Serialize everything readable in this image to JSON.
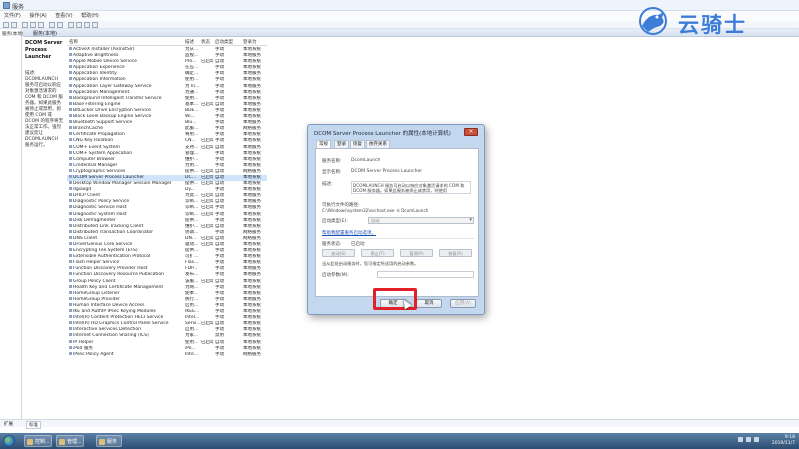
{
  "window": {
    "title": "服务"
  },
  "menu": [
    "文件(F)",
    "操作(A)",
    "查看(V)",
    "帮助(H)"
  ],
  "tree": {
    "root": "服务(本地)"
  },
  "strip": {
    "title": "服务(本地)"
  },
  "description_pane": {
    "title": "DCOM Server Process Launcher",
    "body": "描述:\nDCOMLAUNCH 服务可启动以响应对象激活请求的 COM 和 DCOM 服务器。如果此服务被停止或禁用，则使用 COM 或 DCOM 的程序将无法正常工作。强烈建议您让 DCOMLAUNCH 服务运行。"
  },
  "columns": {
    "name": "名称",
    "desc": "描述",
    "status": "状态",
    "startup": "启动类型",
    "logon": "登录为"
  },
  "services": [
    {
      "name": "ActiveX Installer (AxInstSV)",
      "desc": "为从...",
      "status": "",
      "startup": "手动",
      "logon": "本地系统"
    },
    {
      "name": "Adaptive Brightness",
      "desc": "监视...",
      "status": "",
      "startup": "手动",
      "logon": "本地服务"
    },
    {
      "name": "Apple Mobile Device Service",
      "desc": "Pro...",
      "status": "已启动",
      "startup": "自动",
      "logon": "本地系统"
    },
    {
      "name": "Application Experience",
      "desc": "在应...",
      "status": "",
      "startup": "手动",
      "logon": "本地系统"
    },
    {
      "name": "Application Identity",
      "desc": "确定...",
      "status": "",
      "startup": "手动",
      "logon": "本地服务"
    },
    {
      "name": "Application Information",
      "desc": "使用...",
      "status": "",
      "startup": "手动",
      "logon": "本地系统"
    },
    {
      "name": "Application Layer Gateway Service",
      "desc": "为 In...",
      "status": "",
      "startup": "手动",
      "logon": "本地服务"
    },
    {
      "name": "Application Management",
      "desc": "为通...",
      "status": "",
      "startup": "手动",
      "logon": "本地系统"
    },
    {
      "name": "Background Intelligent Transfer Service",
      "desc": "使用...",
      "status": "",
      "startup": "手动",
      "logon": "本地系统"
    },
    {
      "name": "Base Filtering Engine",
      "desc": "基本...",
      "status": "已启动",
      "startup": "自动",
      "logon": "本地服务"
    },
    {
      "name": "BitLocker Drive Encryption Service",
      "desc": "BDE...",
      "status": "",
      "startup": "手动",
      "logon": "本地系统"
    },
    {
      "name": "Block Level Backup Engine Service",
      "desc": "Wi...",
      "status": "",
      "startup": "手动",
      "logon": "本地系统"
    },
    {
      "name": "Bluetooth Support Service",
      "desc": "Blu...",
      "status": "",
      "startup": "手动",
      "logon": "本地服务"
    },
    {
      "name": "BranchCache",
      "desc": "此服...",
      "status": "",
      "startup": "手动",
      "logon": "网络服务"
    },
    {
      "name": "Certificate Propagation",
      "desc": "将用...",
      "status": "",
      "startup": "手动",
      "logon": "本地系统"
    },
    {
      "name": "CNG Key Isolation",
      "desc": "CN...",
      "status": "已启动",
      "startup": "手动",
      "logon": "本地系统"
    },
    {
      "name": "COM+ Event System",
      "desc": "支持...",
      "status": "已启动",
      "startup": "自动",
      "logon": "本地服务"
    },
    {
      "name": "COM+ System Application",
      "desc": "管理...",
      "status": "",
      "startup": "手动",
      "logon": "本地系统"
    },
    {
      "name": "Computer Browser",
      "desc": "维护...",
      "status": "",
      "startup": "手动",
      "logon": "本地系统"
    },
    {
      "name": "Credential Manager",
      "desc": "为用...",
      "status": "",
      "startup": "手动",
      "logon": "本地系统"
    },
    {
      "name": "Cryptographic Services",
      "desc": "提供...",
      "status": "已启动",
      "startup": "自动",
      "logon": "网络服务"
    },
    {
      "name": "DCOM Server Process Launcher",
      "desc": "DC...",
      "status": "已启动",
      "startup": "自动",
      "logon": "本地系统",
      "selected": true
    },
    {
      "name": "Desktop Window Manager Session Manager",
      "desc": "提供...",
      "status": "已启动",
      "startup": "自动",
      "logon": "本地系统"
    },
    {
      "name": "dgiaxgd",
      "desc": "Dy...",
      "status": "",
      "startup": "手动",
      "logon": "本地系统"
    },
    {
      "name": "DHCP Client",
      "desc": "为此...",
      "status": "已启动",
      "startup": "自动",
      "logon": "本地服务"
    },
    {
      "name": "Diagnostic Policy Service",
      "desc": "诊断...",
      "status": "已启动",
      "startup": "自动",
      "logon": "本地服务"
    },
    {
      "name": "Diagnostic Service Host",
      "desc": "诊断...",
      "status": "已启动",
      "startup": "手动",
      "logon": "本地服务"
    },
    {
      "name": "Diagnostic System Host",
      "desc": "诊断...",
      "status": "已启动",
      "startup": "手动",
      "logon": "本地系统"
    },
    {
      "name": "Disk Defragmenter",
      "desc": "提供...",
      "status": "",
      "startup": "手动",
      "logon": "本地系统"
    },
    {
      "name": "Distributed Link Tracking Client",
      "desc": "维护...",
      "status": "已启动",
      "startup": "自动",
      "logon": "本地系统"
    },
    {
      "name": "Distributed Transaction Coordinator",
      "desc": "协调...",
      "status": "",
      "startup": "手动",
      "logon": "网络服务"
    },
    {
      "name": "DNS Client",
      "desc": "DN...",
      "status": "已启动",
      "startup": "自动",
      "logon": "网络服务"
    },
    {
      "name": "DriverGenius Core Service",
      "desc": "驱动...",
      "status": "已启动",
      "startup": "自动",
      "logon": "本地系统"
    },
    {
      "name": "Encrypting File System (EFS)",
      "desc": "提供...",
      "status": "",
      "startup": "手动",
      "logon": "本地系统"
    },
    {
      "name": "Extensible Authentication Protocol",
      "desc": "可扩...",
      "status": "",
      "startup": "手动",
      "logon": "本地系统"
    },
    {
      "name": "Flash Helper Service",
      "desc": "Flas...",
      "status": "",
      "startup": "手动",
      "logon": "本地系统"
    },
    {
      "name": "Function Discovery Provider Host",
      "desc": "FDP...",
      "status": "",
      "startup": "手动",
      "logon": "本地服务"
    },
    {
      "name": "Function Discovery Resource Publication",
      "desc": "发布...",
      "status": "",
      "startup": "手动",
      "logon": "本地服务"
    },
    {
      "name": "Group Policy Client",
      "desc": "该服...",
      "status": "已启动",
      "startup": "自动",
      "logon": "本地系统"
    },
    {
      "name": "Health Key and Certificate Management",
      "desc": "为网...",
      "status": "",
      "startup": "手动",
      "logon": "本地系统"
    },
    {
      "name": "HomeGroup Listener",
      "desc": "使本...",
      "status": "",
      "startup": "手动",
      "logon": "本地系统"
    },
    {
      "name": "HomeGroup Provider",
      "desc": "执行...",
      "status": "",
      "startup": "手动",
      "logon": "本地服务"
    },
    {
      "name": "Human Interface Device Access",
      "desc": "启用...",
      "status": "",
      "startup": "手动",
      "logon": "本地系统"
    },
    {
      "name": "IKE and AuthIP IPsec Keying Modules",
      "desc": "IKEE...",
      "status": "",
      "startup": "手动",
      "logon": "本地系统"
    },
    {
      "name": "Intel(R) Content Protection HECI Service",
      "desc": "Intel...",
      "status": "",
      "startup": "手动",
      "logon": "本地系统"
    },
    {
      "name": "Intel(R) HD Graphics Control Panel Service",
      "desc": "Servi...",
      "status": "已启动",
      "startup": "自动",
      "logon": "本地系统"
    },
    {
      "name": "Interactive Services Detection",
      "desc": "启用...",
      "status": "",
      "startup": "手动",
      "logon": "本地系统"
    },
    {
      "name": "Internet Connection Sharing (ICS)",
      "desc": "为家...",
      "status": "",
      "startup": "禁用",
      "logon": "本地系统"
    },
    {
      "name": "IP Helper",
      "desc": "使用...",
      "status": "已启动",
      "startup": "自动",
      "logon": "本地系统"
    },
    {
      "name": "iPod 服务",
      "desc": "iPo...",
      "status": "",
      "startup": "手动",
      "logon": "本地系统"
    },
    {
      "name": "IPsec Policy Agent",
      "desc": "Inte...",
      "status": "",
      "startup": "手动",
      "logon": "网络服务"
    }
  ],
  "bottom_tabs": {
    "extended": "扩展",
    "standard": "标准"
  },
  "taskbar": {
    "tasks": [
      "控制...",
      "管理...",
      "服务"
    ],
    "time": "9:18",
    "date": "2019/11/7"
  },
  "watermark": {
    "text": "云骑士"
  },
  "dialog": {
    "title": "DCOM Server Process Launcher 的属性(本地计算机)",
    "close_label": "×",
    "tabs": [
      "常规",
      "登录",
      "恢复",
      "依存关系"
    ],
    "service_name_label": "服务名称:",
    "service_name": "DcomLaunch",
    "display_name_label": "显示名称:",
    "display_name": "DCOM Server Process Launcher",
    "description_label": "描述:",
    "description": "DCOMLAUNCH 服务可启动以响应对象激活请求的 COM 和 DCOM 服务器。如果此服务被停止或禁用，则使用",
    "path_label": "可执行文件的路径:",
    "path": "C:\\Windows\\system32\\svchost.exe -k DcomLaunch",
    "startup_type_label": "启动类型(E):",
    "startup_type": "自动",
    "help_link": "帮助我配置服务启动选项。",
    "status_label": "服务状态:",
    "status": "已启动",
    "start_button": "启动(S)",
    "stop_button": "停止(T)",
    "pause_button": "暂停(P)",
    "resume_button": "恢复(R)",
    "hint": "当从此处启动服务时，您可指定所适用的启动参数。",
    "params_label": "启动参数(M):",
    "ok_button": "确定",
    "cancel_button": "取消",
    "apply_button": "应用(A)"
  }
}
